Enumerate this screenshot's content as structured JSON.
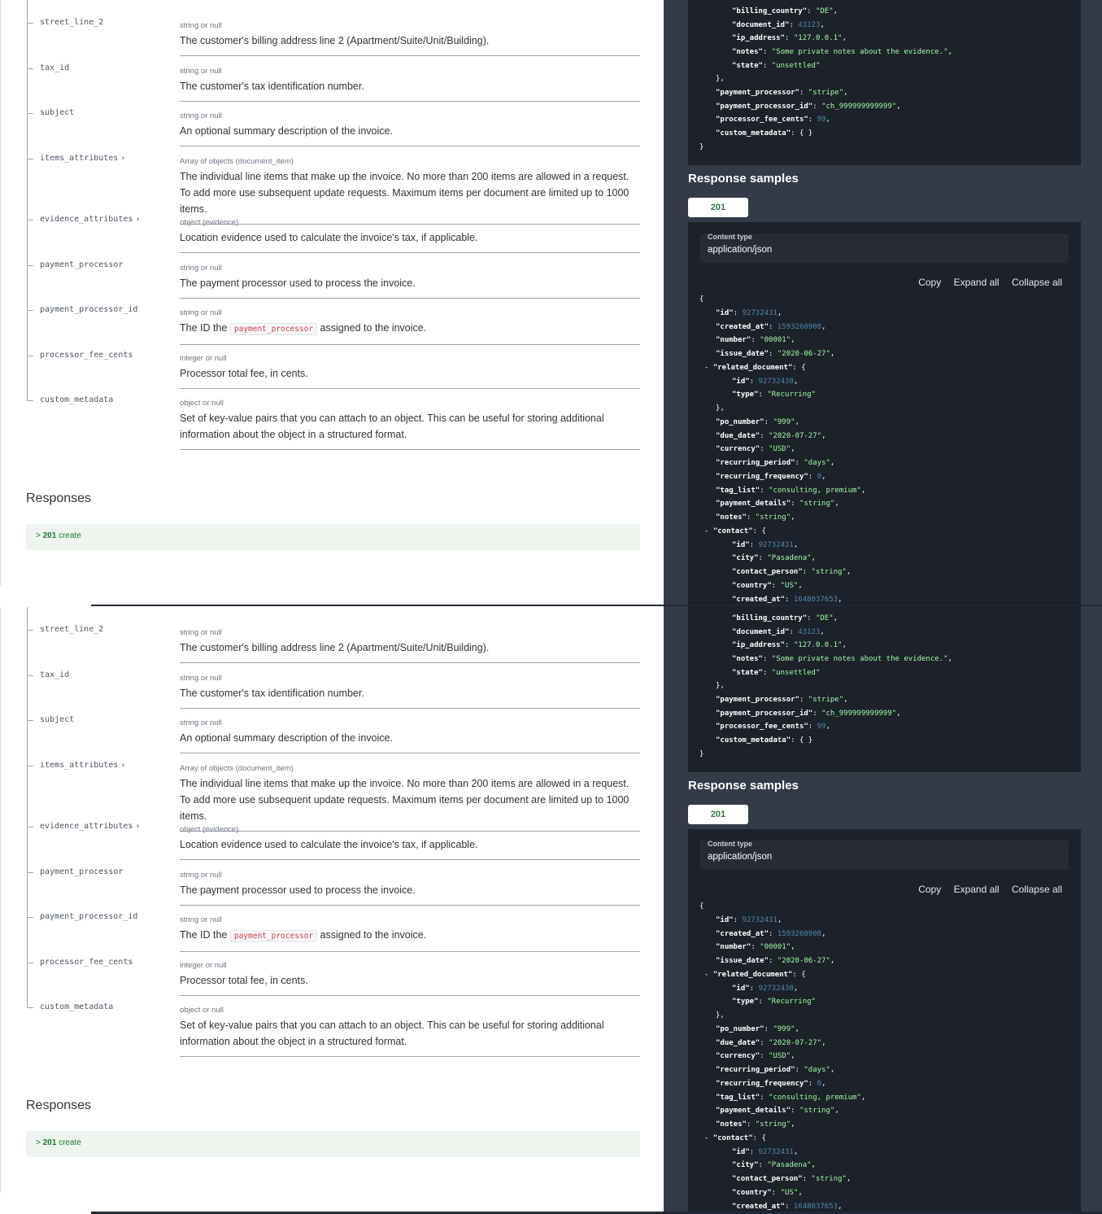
{
  "params": [
    {
      "name": "street_line_2",
      "has_children": false,
      "type": "string or null",
      "desc": "The customer's billing address line 2 (Apartment/Suite/Unit/Building)."
    },
    {
      "name": "tax_id",
      "has_children": false,
      "type": "string or null",
      "desc": "The customer's tax identification number."
    },
    {
      "name": "subject",
      "has_children": false,
      "type": "string or null",
      "desc": "An optional summary description of the invoice."
    },
    {
      "name": "items_attributes",
      "has_children": true,
      "type": "Array of objects (document_item)",
      "desc": "The individual line items that make up the invoice. No more than 200 items are allowed in a request. To add more use subsequent update requests. Maximum items per document are limited up to 1000 items."
    },
    {
      "name": "evidence_attributes",
      "has_children": true,
      "type": "object (evidence)",
      "desc": "Location evidence used to calculate the invoice's tax, if applicable."
    },
    {
      "name": "payment_processor",
      "has_children": false,
      "type": "string or null",
      "desc": "The payment processor used to process the invoice."
    },
    {
      "name": "payment_processor_id",
      "has_children": false,
      "type": "string or null",
      "desc_before": "The ID the ",
      "desc_code": "payment_processor",
      "desc_after": " assigned to the invoice."
    },
    {
      "name": "processor_fee_cents",
      "has_children": false,
      "type": "integer or null",
      "desc": "Processor total fee, in cents."
    },
    {
      "name": "custom_metadata",
      "has_children": false,
      "type": "object or null",
      "desc": "Set of key-value pairs that you can attach to an object. This can be useful for storing additional information about the object in a structured format."
    }
  ],
  "responses": {
    "heading": "Responses",
    "items": [
      {
        "code": "201",
        "label": "create"
      }
    ]
  },
  "request_tail": [
    [
      "k",
      "\"billing_country\"",
      "s",
      "\"DE\"",
      ","
    ],
    [
      "k",
      "\"document_id\"",
      "n",
      "43123",
      ","
    ],
    [
      "k",
      "\"ip_address\"",
      "s",
      "\"127.0.0.1\"",
      ","
    ],
    [
      "k",
      "\"notes\"",
      "s",
      "\"Some private notes about the evidence.\"",
      ","
    ],
    [
      "k",
      "\"state\"",
      "s",
      "\"unsettled\"",
      ""
    ]
  ],
  "request_tail2": [
    [
      "k",
      "\"payment_processor\"",
      "s",
      "\"stripe\"",
      ","
    ],
    [
      "k",
      "\"payment_processor_id\"",
      "s",
      "\"ch_999999999999\"",
      ","
    ],
    [
      "k",
      "\"processor_fee_cents\"",
      "n",
      "99",
      ","
    ],
    [
      "k",
      "\"custom_metadata\"",
      "p",
      "{ }",
      ""
    ]
  ],
  "response_samples": {
    "title": "Response samples",
    "tab": "201",
    "content_type_label": "Content type",
    "content_type": "application/json",
    "actions": [
      "Copy",
      "Expand all",
      "Collapse all"
    ]
  },
  "response_json": {
    "top": [
      [
        "\"id\"",
        "n",
        "92732431",
        ","
      ],
      [
        "\"created_at\"",
        "n",
        "1593260908",
        ","
      ],
      [
        "\"number\"",
        "s",
        "\"00001\"",
        ","
      ],
      [
        "\"issue_date\"",
        "s",
        "\"2020-06-27\"",
        ","
      ]
    ],
    "related_key": "\"related_document\"",
    "related": [
      [
        "\"id\"",
        "n",
        "92732430",
        ","
      ],
      [
        "\"type\"",
        "s",
        "\"Recurring\"",
        ""
      ]
    ],
    "mid": [
      [
        "\"po_number\"",
        "s",
        "\"999\"",
        ","
      ],
      [
        "\"due_date\"",
        "s",
        "\"2020-07-27\"",
        ","
      ],
      [
        "\"currency\"",
        "s",
        "\"USD\"",
        ","
      ],
      [
        "\"recurring_period\"",
        "s",
        "\"days\"",
        ","
      ],
      [
        "\"recurring_frequency\"",
        "n",
        "0",
        ","
      ],
      [
        "\"tag_list\"",
        "s",
        "\"consulting, premium\"",
        ","
      ],
      [
        "\"payment_details\"",
        "s",
        "\"string\"",
        ","
      ],
      [
        "\"notes\"",
        "s",
        "\"string\"",
        ","
      ]
    ],
    "contact_key": "\"contact\"",
    "contact": [
      [
        "\"id\"",
        "n",
        "92732431",
        ","
      ],
      [
        "\"city\"",
        "s",
        "\"Pasadena\"",
        ","
      ],
      [
        "\"contact_person\"",
        "s",
        "\"string\"",
        ","
      ],
      [
        "\"country\"",
        "s",
        "\"US\"",
        ","
      ],
      [
        "\"created_at\"",
        "n",
        "1648037653",
        ","
      ]
    ]
  }
}
